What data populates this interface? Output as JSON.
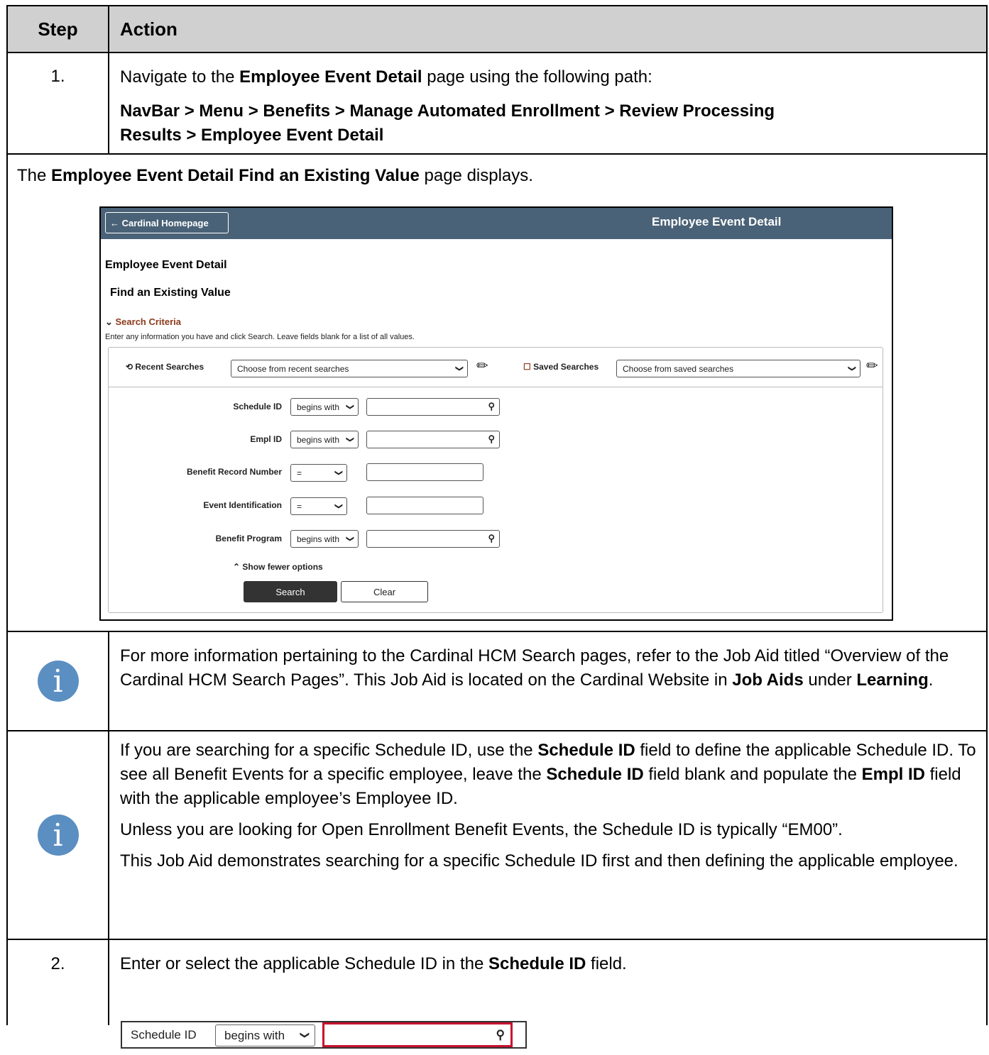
{
  "table": {
    "col_step": "Step",
    "col_action": "Action"
  },
  "step1": {
    "number": "1.",
    "line1_pre": "Navigate to the ",
    "line1_bold": "Employee Event Detail",
    "line1_post": " page using the following path:",
    "path_line1": "NavBar > Menu > Benefits > Manage Automated Enrollment > Review Processing",
    "path_line2": "Results > Employee Event Detail"
  },
  "displays": {
    "pre": "The ",
    "bold": "Employee Event Detail Find an Existing Value",
    "post": " page displays."
  },
  "screenshot": {
    "home_button": "Cardinal Homepage",
    "bar_title": "Employee Event Detail",
    "page_title": "Employee Event Detail",
    "subtitle": "Find an Existing Value",
    "criteria": "Search Criteria",
    "hint": "Enter any information you have and click Search. Leave fields blank for a list of all values.",
    "recent_label": "Recent Searches",
    "recent_value": "Choose from recent searches",
    "saved_label": "Saved Searches",
    "saved_value": "Choose from saved searches",
    "fields": [
      {
        "label": "Schedule ID",
        "operator": "begins with"
      },
      {
        "label": "Empl ID",
        "operator": "begins with"
      },
      {
        "label": "Benefit Record Number",
        "operator": "="
      },
      {
        "label": "Event Identification",
        "operator": "="
      },
      {
        "label": "Benefit Program",
        "operator": "begins with"
      }
    ],
    "fewer": "Show fewer options",
    "search_btn": "Search",
    "clear_btn": "Clear"
  },
  "info1": {
    "icon": "info-icon",
    "text_pre": "For more information pertaining to the Cardinal HCM Search pages, refer to the Job Aid titled “Overview of the Cardinal HCM Search Pages”.  This Job Aid is located on the Cardinal Website in ",
    "bold1": "Job Aids",
    "mid": " under ",
    "bold2": "Learning",
    "end": "."
  },
  "info2": {
    "icon": "info-icon",
    "p1_a": "If you are searching for a specific Schedule ID, use the ",
    "p1_b": "Schedule ID",
    "p1_c": " field to define the applicable Schedule ID.  To see all Benefit Events for a specific employee, leave the ",
    "p1_d": "Schedule ID",
    "p1_e": " field blank and populate the ",
    "p1_f": "Empl ID",
    "p1_g": " field with the applicable employee’s Employee ID.",
    "p2": "Unless you are looking for Open Enrollment Benefit Events, the Schedule ID is typically “EM00”.",
    "p3": "This Job Aid demonstrates searching for a specific Schedule ID first and then defining the applicable employee."
  },
  "step2": {
    "number": "2.",
    "pre": "Enter or select the applicable Schedule ID in the ",
    "bold": "Schedule ID",
    "post": " field.",
    "mini_label": "Schedule ID",
    "mini_operator": "begins with"
  }
}
